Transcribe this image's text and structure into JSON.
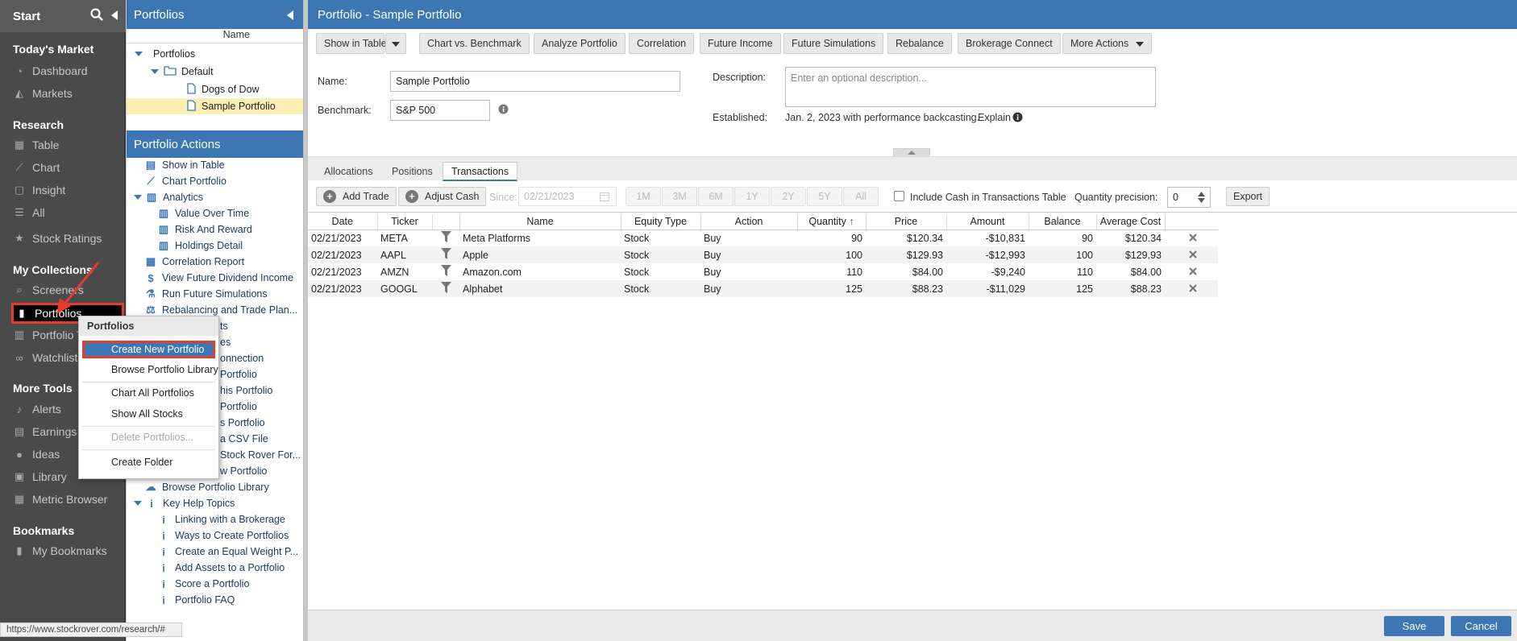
{
  "nav": {
    "start": "Start",
    "sections": {
      "todays_market": "Today's Market",
      "research": "Research",
      "my_collections": "My Collections",
      "more_tools": "More Tools",
      "bookmarks": "Bookmarks"
    },
    "items": {
      "dashboard": "Dashboard",
      "markets": "Markets",
      "table": "Table",
      "chart": "Chart",
      "insight": "Insight",
      "all": "All",
      "stock_ratings": "Stock Ratings",
      "screeners": "Screeners",
      "portfolios": "Portfolios",
      "portfolio_t": "Portfolio T",
      "watchlists": "Watchlists",
      "alerts": "Alerts",
      "earnings": "Earnings",
      "ideas": "Ideas",
      "library": "Library",
      "metric_browser": "Metric Browser",
      "my_bookmarks": "My Bookmarks"
    }
  },
  "tree": {
    "title": "Portfolios",
    "column_name": "Name",
    "nodes": {
      "root": "Portfolios",
      "default": "Default",
      "dogs": "Dogs of Dow",
      "sample": "Sample Portfolio"
    }
  },
  "actions": {
    "title": "Portfolio Actions",
    "items": [
      "Show in Table",
      "Chart Portfolio",
      "Analytics",
      "Value Over Time",
      "Risk And Reward",
      "Holdings Detail",
      "Correlation Report",
      "View Future Dividend Income",
      "Run Future Simulations",
      "Rebalancing and Trade Plan...",
      "ts",
      "es",
      "onnection",
      "Portfolio",
      "his Portfolio",
      "Portfolio",
      "s Portfolio",
      "a CSV File",
      "Stock Rover For...",
      "w Portfolio",
      "Browse Portfolio Library",
      "Key Help Topics",
      "Linking with a Brokerage",
      "Ways to Create Portfolios",
      "Create an Equal Weight P...",
      "Add Assets to a Portfolio",
      "Score a Portfolio",
      "Portfolio FAQ"
    ]
  },
  "context_menu": {
    "title": "Portfolios",
    "items": {
      "create_new": "Create New Portfolio",
      "browse_library": "Browse Portfolio Library",
      "chart_all": "Chart All Portfolios",
      "show_all": "Show All Stocks",
      "delete": "Delete Portfolios...",
      "create_folder": "Create Folder"
    }
  },
  "main": {
    "title": "Portfolio - Sample Portfolio",
    "toolbar": {
      "show_in_table": "Show in Table",
      "chart_vs_benchmark": "Chart vs. Benchmark",
      "analyze": "Analyze Portfolio",
      "correlation": "Correlation",
      "future_income": "Future Income",
      "future_simulations": "Future Simulations",
      "rebalance": "Rebalance",
      "brokerage_connect": "Brokerage Connect",
      "more_actions": "More Actions"
    },
    "form": {
      "name_label": "Name:",
      "name_value": "Sample Portfolio",
      "benchmark_label": "Benchmark:",
      "benchmark_value": "S&P 500",
      "description_label": "Description:",
      "description_placeholder": "Enter an optional description...",
      "established_label": "Established:",
      "established_value": "Jan. 2, 2023 with performance backcasting.",
      "explain": "Explain"
    },
    "tabs": {
      "allocations": "Allocations",
      "positions": "Positions",
      "transactions": "Transactions"
    },
    "subtoolbar": {
      "add_trade": "Add Trade",
      "adjust_cash": "Adjust Cash",
      "since": "Since:",
      "since_date": "02/21/2023",
      "ranges": [
        "1M",
        "3M",
        "6M",
        "1Y",
        "2Y",
        "5Y",
        "All"
      ],
      "include_cash": "Include Cash in Transactions Table",
      "quantity_precision": "Quantity precision:",
      "precision_value": "0",
      "export": "Export"
    },
    "table": {
      "headers": {
        "date": "Date",
        "ticker": "Ticker",
        "name": "Name",
        "equity_type": "Equity Type",
        "action": "Action",
        "quantity": "Quantity",
        "price": "Price",
        "amount": "Amount",
        "balance": "Balance",
        "average_cost": "Average Cost"
      },
      "rows": [
        {
          "date": "02/21/2023",
          "ticker": "META",
          "name": "Meta Platforms",
          "equity_type": "Stock",
          "action": "Buy",
          "quantity": "90",
          "price": "$120.34",
          "amount": "-$10,831",
          "balance": "90",
          "average_cost": "$120.34"
        },
        {
          "date": "02/21/2023",
          "ticker": "AAPL",
          "name": "Apple",
          "equity_type": "Stock",
          "action": "Buy",
          "quantity": "100",
          "price": "$129.93",
          "amount": "-$12,993",
          "balance": "100",
          "average_cost": "$129.93"
        },
        {
          "date": "02/21/2023",
          "ticker": "AMZN",
          "name": "Amazon.com",
          "equity_type": "Stock",
          "action": "Buy",
          "quantity": "110",
          "price": "$84.00",
          "amount": "-$9,240",
          "balance": "110",
          "average_cost": "$84.00"
        },
        {
          "date": "02/21/2023",
          "ticker": "GOOGL",
          "name": "Alphabet",
          "equity_type": "Stock",
          "action": "Buy",
          "quantity": "125",
          "price": "$88.23",
          "amount": "-$11,029",
          "balance": "125",
          "average_cost": "$88.23"
        }
      ]
    }
  },
  "footer": {
    "save": "Save",
    "cancel": "Cancel"
  },
  "status_url": "https://www.stockrover.com/research/#",
  "colors": {
    "accent": "#3d77b3",
    "highlight_border": "#e53b2c",
    "nav_bg": "#4a4a4a"
  }
}
